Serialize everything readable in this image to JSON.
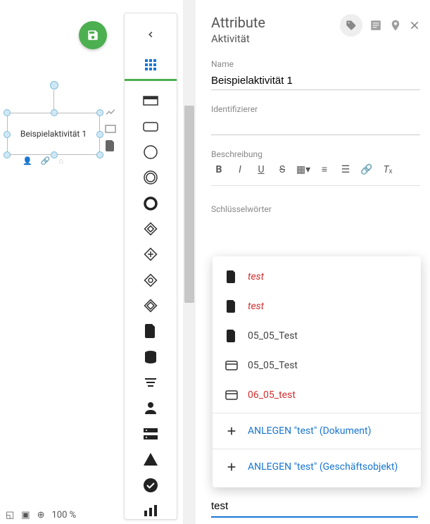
{
  "canvas": {
    "node_label": "Beispielaktivität 1",
    "zoom": "100 %"
  },
  "panel": {
    "title": "Attribute",
    "subtitle": "Aktivität",
    "name_label": "Name",
    "name_value": "Beispielaktivität 1",
    "identifier_label": "Identifizierer",
    "identifier_value": "",
    "description_label": "Beschreibung",
    "keywords_label": "Schlüsselwörter",
    "search_value": "test"
  },
  "dropdown": {
    "items": [
      {
        "icon": "file",
        "label": "test",
        "style": "red"
      },
      {
        "icon": "file",
        "label": "test",
        "style": "red"
      },
      {
        "icon": "file",
        "label": "05_05_Test",
        "style": "normal"
      },
      {
        "icon": "card",
        "label": "05_05_Test",
        "style": "normal"
      },
      {
        "icon": "card",
        "label": "06_05_test",
        "style": "red-noitalic"
      }
    ],
    "create_doc": "ANLEGEN \"test\" (Dokument)",
    "create_obj": "ANLEGEN \"test\" (Geschäftsobjekt)"
  }
}
